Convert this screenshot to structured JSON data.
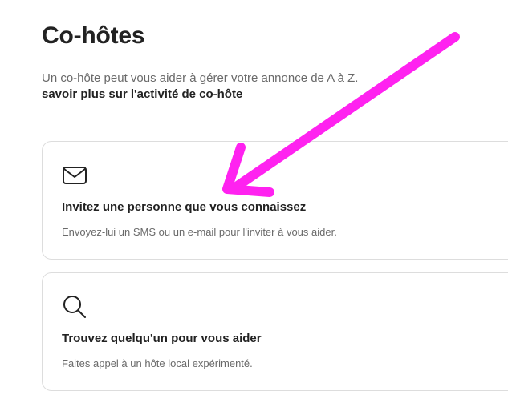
{
  "page": {
    "title": "Co-hôtes",
    "intro_text": "Un co-hôte peut vous aider à gérer votre annonce de A à Z.",
    "learn_more": "savoir plus sur l'activité de co-hôte"
  },
  "cards": [
    {
      "icon": "envelope-icon",
      "title": "Invitez une personne que vous connaissez",
      "description": "Envoyez-lui un SMS ou un e-mail pour l'inviter à vous aider."
    },
    {
      "icon": "search-icon",
      "title": "Trouvez quelqu'un pour vous aider",
      "description": "Faites appel à un hôte local expérimenté."
    }
  ],
  "annotation": {
    "arrow_color": "#ff22f0"
  },
  "colors": {
    "text_primary": "#222222",
    "text_secondary": "#6a6a6a",
    "border": "#dddddd"
  }
}
